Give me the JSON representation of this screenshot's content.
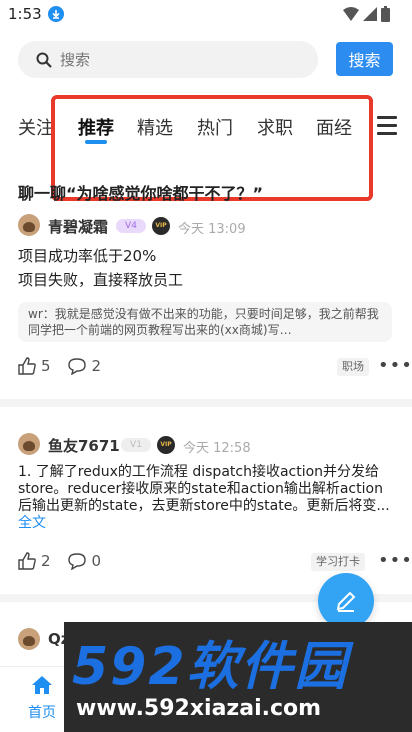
{
  "status_bar": {
    "time": "1:53"
  },
  "search": {
    "placeholder": "搜索",
    "button_label": "搜索"
  },
  "tabs": [
    {
      "label": "关注"
    },
    {
      "label": "推荐",
      "active": true
    },
    {
      "label": "精选"
    },
    {
      "label": "热门"
    },
    {
      "label": "求职"
    },
    {
      "label": "面经"
    }
  ],
  "post1": {
    "title": "聊一聊“为啥感觉你啥都干不了？”",
    "author": "青碧凝霜",
    "time": "今天 13:09",
    "lines": [
      "项目成功率低于20%",
      "项目失败，直接释放员工"
    ],
    "comment": "wr：我就是感觉没有做不出来的功能，只要时间足够，我之前帮我同学把一个前端的网页教程写出来的(xx商城)写…",
    "likes": "5",
    "comments": "2",
    "tag": "职场"
  },
  "post2": {
    "author": "鱼友7671",
    "time": "今天 12:58",
    "body": "1. 了解了redux的工作流程 dispatch接收action并分发给store。reducer接收原来的state和action输出解析action后输出更新的state，去更新store中的state。更新后将变...",
    "full_link": "全文",
    "likes": "2",
    "comments": "0",
    "tag": "学习打卡"
  },
  "post3": {
    "author": "Qz"
  },
  "bottom_nav": {
    "home_label": "首页"
  },
  "watermark": {
    "big": "592软件园",
    "small": "www.592xiazai.com"
  },
  "colors": {
    "accent": "#1f8ef1",
    "highlight": "#e8392b"
  }
}
